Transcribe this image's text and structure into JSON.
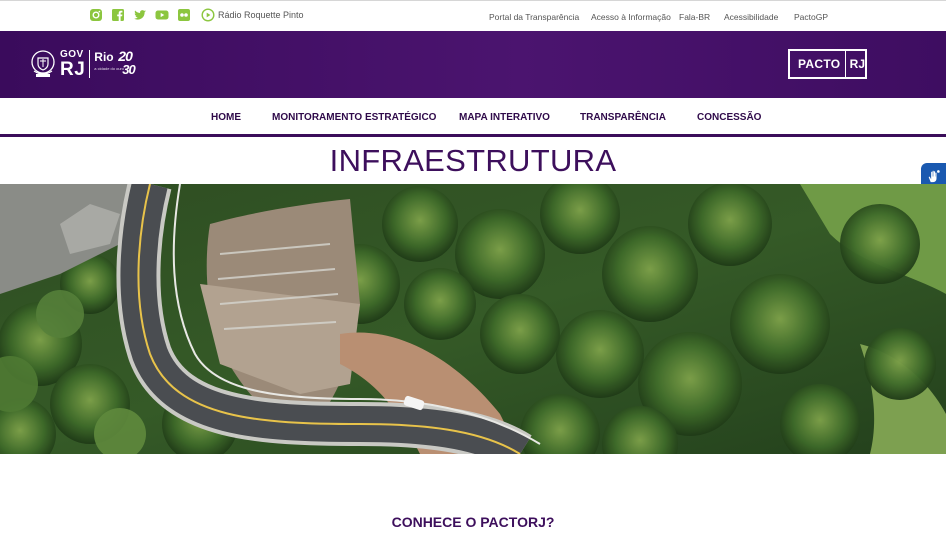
{
  "topbar": {
    "social_icons": [
      "instagram-icon",
      "facebook-icon",
      "twitter-icon",
      "youtube-icon",
      "flickr-icon",
      "play-circle-icon"
    ],
    "radio_label": "Rádio Roquette Pinto",
    "links": [
      "Portal da Transparência",
      "Acesso à Informação",
      "Fala-BR",
      "Acessibilidade",
      "PactoGP"
    ],
    "icon_color": "#8cc63f"
  },
  "header": {
    "gov_line1": "GOV",
    "gov_line2": "RJ",
    "rio_word": "Rio",
    "rio_num": "20",
    "rio_30": "30",
    "rio_sub": "a cidade do ouro",
    "pacto_left": "PACTO",
    "pacto_right": "RJ",
    "background": "#4b146f"
  },
  "nav": {
    "items": [
      "HOME",
      "MONITORAMENTO ESTRATÉGICO",
      "MAPA INTERATIVO",
      "TRANSPARÊNCIA",
      "CONCESSÃO"
    ],
    "color": "#2f0a4a"
  },
  "main": {
    "page_title": "INFRAESTRUTURA",
    "hero_image": "aerial view of a curved road through forest",
    "about_heading": "CONHECE O PACTORJ?"
  },
  "accessibility": {
    "vlibras_icon": "hand-sign-icon",
    "color": "#1a59b0"
  }
}
